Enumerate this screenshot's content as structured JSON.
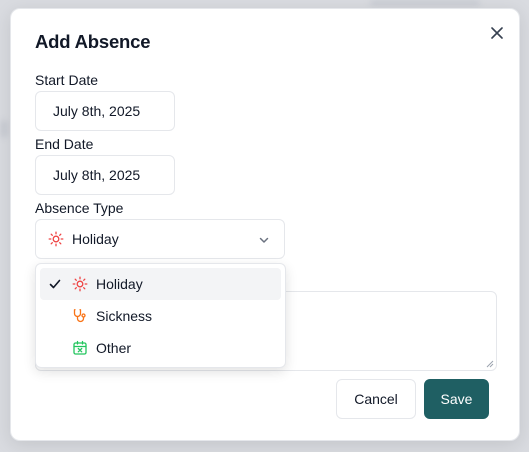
{
  "dialog": {
    "title": "Add Absence",
    "close_icon": "close-icon",
    "start_date": {
      "label": "Start Date",
      "value": "July 8th, 2025"
    },
    "end_date": {
      "label": "End Date",
      "value": "July 8th, 2025"
    },
    "absence_type": {
      "label": "Absence Type",
      "selected": "Holiday",
      "selected_icon": "sun-icon",
      "options": [
        {
          "label": "Holiday",
          "icon": "sun-icon",
          "color": "#ef4444",
          "selected": true
        },
        {
          "label": "Sickness",
          "icon": "stethoscope-icon",
          "color": "#f97316",
          "selected": false
        },
        {
          "label": "Other",
          "icon": "calendar-x-icon",
          "color": "#22c55e",
          "selected": false
        }
      ]
    },
    "buttons": {
      "cancel": "Cancel",
      "save": "Save"
    }
  },
  "colors": {
    "primary": "#1f5f63",
    "border": "#e5e7eb",
    "holiday": "#ef4444",
    "sickness": "#f97316",
    "other": "#22c55e"
  }
}
